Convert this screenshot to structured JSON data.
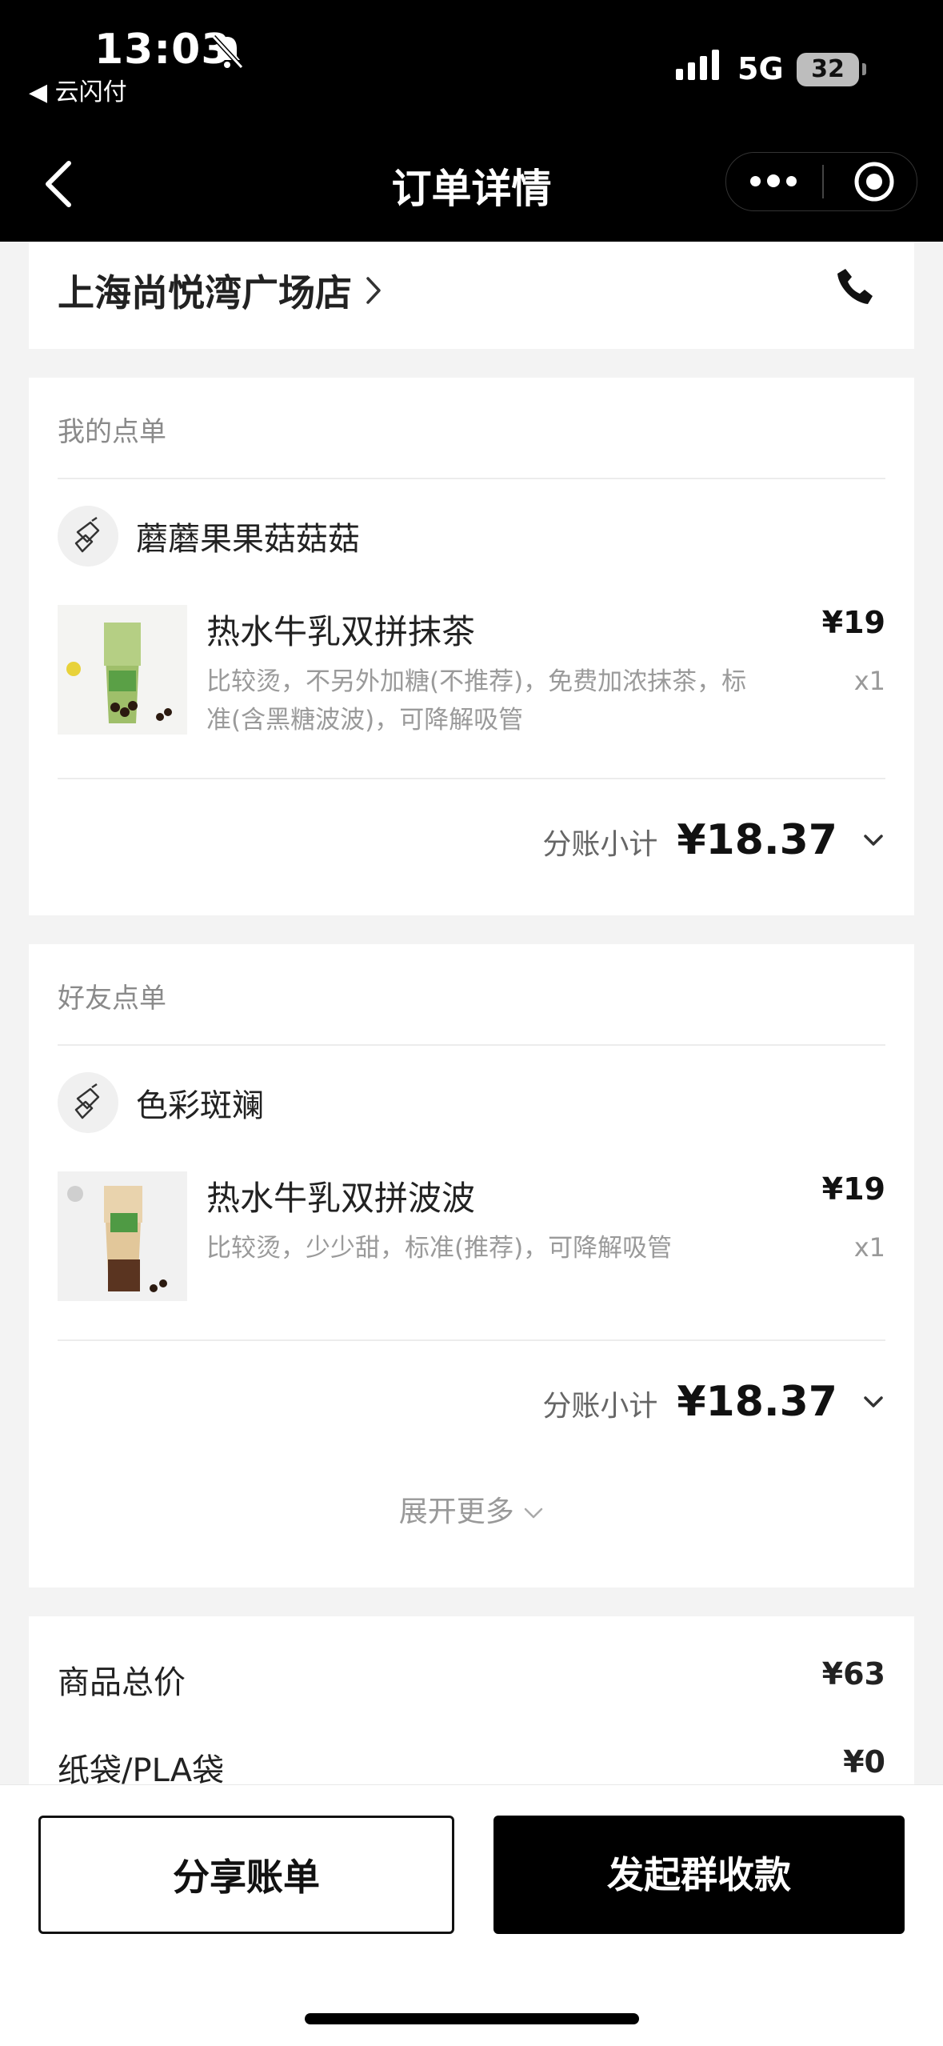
{
  "status_bar": {
    "time": "13:03",
    "back_app": "◀ 云闪付",
    "network": "5G",
    "battery": "32"
  },
  "nav": {
    "title": "订单详情"
  },
  "store": {
    "name": "上海尚悦湾广场店"
  },
  "my_order": {
    "section_title": "我的点单",
    "user": "蘑蘑果果菇菇菇",
    "item": {
      "name": "热水牛乳双拼抹茶",
      "options": "比较烫，不另外加糖(不推荐)，免费加浓抹茶，标准(含黑糖波波)，可降解吸管",
      "price": "¥19",
      "qty": "x1"
    },
    "subtotal_label": "分账小计",
    "subtotal": "¥18.37"
  },
  "friend_order": {
    "section_title": "好友点单",
    "user": "色彩斑斓",
    "item": {
      "name": "热水牛乳双拼波波",
      "options": "比较烫，少少甜，标准(推荐)，可降解吸管",
      "price": "¥19",
      "qty": "x1"
    },
    "subtotal_label": "分账小计",
    "subtotal": "¥18.37",
    "expand": "展开更多"
  },
  "summary": {
    "rows": [
      {
        "label": "商品总价",
        "value": "¥63"
      },
      {
        "label": "纸袋/PLA袋",
        "value": "¥0"
      }
    ]
  },
  "actions": {
    "share": "分享账单",
    "collect": "发起群收款"
  }
}
